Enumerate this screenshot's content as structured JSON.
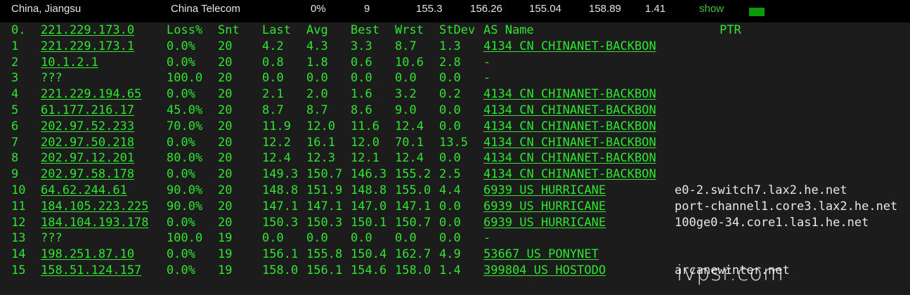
{
  "summary": {
    "location": "China, Jiangsu",
    "isp": "China Telecom",
    "loss": "0%",
    "count": "9",
    "v1": "155.3",
    "v2": "156.26",
    "v3": "155.04",
    "v4": "158.89",
    "v5": "1.41",
    "show_label": "show"
  },
  "header": {
    "hop": "0.",
    "host": "221.229.173.0",
    "loss": "Loss%",
    "snt": "Snt",
    "last": "Last",
    "avg": "Avg",
    "best": "Best",
    "wrst": "Wrst",
    "stdev": "StDev",
    "asname": "AS Name",
    "ptr": "PTR"
  },
  "hops": [
    {
      "hop": "1",
      "host": "221.229.173.1",
      "loss": "0.0%",
      "snt": "20",
      "last": "4.2",
      "avg": "4.3",
      "best": "3.3",
      "wrst": "8.7",
      "stdev": "1.3",
      "asn": "4134",
      "cc": "CN",
      "asname": "CHINANET-BACKBON",
      "ptr": ""
    },
    {
      "hop": "2",
      "host": "10.1.2.1",
      "loss": "0.0%",
      "snt": "20",
      "last": "0.8",
      "avg": "1.8",
      "best": "0.6",
      "wrst": "10.6",
      "stdev": "2.8",
      "asn": "",
      "cc": "",
      "asname": "-",
      "ptr": ""
    },
    {
      "hop": "3",
      "host": "???",
      "loss": "100.0",
      "snt": "20",
      "last": "0.0",
      "avg": "0.0",
      "best": "0.0",
      "wrst": "0.0",
      "stdev": "0.0",
      "asn": "",
      "cc": "",
      "asname": "-",
      "ptr": ""
    },
    {
      "hop": "4",
      "host": "221.229.194.65",
      "loss": "0.0%",
      "snt": "20",
      "last": "2.1",
      "avg": "2.0",
      "best": "1.6",
      "wrst": "3.2",
      "stdev": "0.2",
      "asn": "4134",
      "cc": "CN",
      "asname": "CHINANET-BACKBON",
      "ptr": ""
    },
    {
      "hop": "5",
      "host": "61.177.216.17",
      "loss": "45.0%",
      "snt": "20",
      "last": "8.7",
      "avg": "8.7",
      "best": "8.6",
      "wrst": "9.0",
      "stdev": "0.0",
      "asn": "4134",
      "cc": "CN",
      "asname": "CHINANET-BACKBON",
      "ptr": ""
    },
    {
      "hop": "6",
      "host": "202.97.52.233",
      "loss": "70.0%",
      "snt": "20",
      "last": "11.9",
      "avg": "12.0",
      "best": "11.6",
      "wrst": "12.4",
      "stdev": "0.0",
      "asn": "4134",
      "cc": "CN",
      "asname": "CHINANET-BACKBON",
      "ptr": ""
    },
    {
      "hop": "7",
      "host": "202.97.50.218",
      "loss": "0.0%",
      "snt": "20",
      "last": "12.2",
      "avg": "16.1",
      "best": "12.0",
      "wrst": "70.1",
      "stdev": "13.5",
      "asn": "4134",
      "cc": "CN",
      "asname": "CHINANET-BACKBON",
      "ptr": ""
    },
    {
      "hop": "8",
      "host": "202.97.12.201",
      "loss": "80.0%",
      "snt": "20",
      "last": "12.4",
      "avg": "12.3",
      "best": "12.1",
      "wrst": "12.4",
      "stdev": "0.0",
      "asn": "4134",
      "cc": "CN",
      "asname": "CHINANET-BACKBON",
      "ptr": ""
    },
    {
      "hop": "9",
      "host": "202.97.58.178",
      "loss": "0.0%",
      "snt": "20",
      "last": "149.3",
      "avg": "150.7",
      "best": "146.3",
      "wrst": "155.2",
      "stdev": "2.5",
      "asn": "4134",
      "cc": "CN",
      "asname": "CHINANET-BACKBON",
      "ptr": ""
    },
    {
      "hop": "10",
      "host": "64.62.244.61",
      "loss": "90.0%",
      "snt": "20",
      "last": "148.8",
      "avg": "151.9",
      "best": "148.8",
      "wrst": "155.0",
      "stdev": "4.4",
      "asn": "6939",
      "cc": "US",
      "asname": "HURRICANE",
      "ptr": "e0-2.switch7.lax2.he.net"
    },
    {
      "hop": "11",
      "host": "184.105.223.225",
      "loss": "90.0%",
      "snt": "20",
      "last": "147.1",
      "avg": "147.1",
      "best": "147.0",
      "wrst": "147.1",
      "stdev": "0.0",
      "asn": "6939",
      "cc": "US",
      "asname": "HURRICANE",
      "ptr": "port-channel1.core3.lax2.he.net"
    },
    {
      "hop": "12",
      "host": "184.104.193.178",
      "loss": "0.0%",
      "snt": "20",
      "last": "150.3",
      "avg": "150.3",
      "best": "150.1",
      "wrst": "150.7",
      "stdev": "0.0",
      "asn": "6939",
      "cc": "US",
      "asname": "HURRICANE",
      "ptr": "100ge0-34.core1.las1.he.net"
    },
    {
      "hop": "13",
      "host": "???",
      "loss": "100.0",
      "snt": "19",
      "last": "0.0",
      "avg": "0.0",
      "best": "0.0",
      "wrst": "0.0",
      "stdev": "0.0",
      "asn": "",
      "cc": "",
      "asname": "-",
      "ptr": ""
    },
    {
      "hop": "14",
      "host": "198.251.87.10",
      "loss": "0.0%",
      "snt": "19",
      "last": "156.1",
      "avg": "155.8",
      "best": "150.4",
      "wrst": "162.7",
      "stdev": "4.9",
      "asn": "53667",
      "cc": "US",
      "asname": "PONYNET",
      "ptr": ""
    },
    {
      "hop": "15",
      "host": "158.51.124.157",
      "loss": "0.0%",
      "snt": "19",
      "last": "158.0",
      "avg": "156.1",
      "best": "154.6",
      "wrst": "158.0",
      "stdev": "1.4",
      "asn": "399804",
      "cc": "US",
      "asname": "HOSTODO",
      "ptr": "arcanewinter.net"
    }
  ],
  "watermark": "ivpsr.com",
  "colors": {
    "terminal_green": "#2fe52f",
    "panel_bg": "#1c1c1c",
    "page_bg": "#000000"
  }
}
